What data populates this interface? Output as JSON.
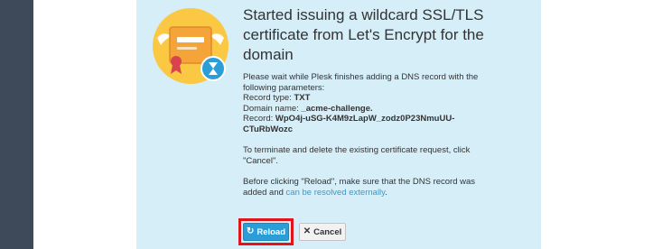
{
  "colors": {
    "panel_background": "#d6eef8",
    "accent": "#2b9ed8",
    "highlight_border": "#e0151b",
    "icon_circle": "#fbc843",
    "left_strip": "#3e4a5a"
  },
  "dialog": {
    "title": "Started issuing a wildcard SSL/TLS certificate from Let's Encrypt for the domain",
    "wait_message": "Please wait while Plesk finishes adding a DNS record with the following parameters:",
    "record_type_label": "Record type: ",
    "record_type_value": "TXT",
    "domain_name_label": "Domain name: ",
    "domain_name_value": "_acme-challenge.",
    "record_label": "Record: ",
    "record_value": "WpO4j-uSG-K4M9zLapW_zodz0P23NmuUU-CTuRbWozc",
    "terminate_message": "To terminate and delete the existing certificate request, click \"Cancel\".",
    "before_reload_prefix": "Before clicking \"Reload\", make sure that the DNS record was added and ",
    "resolved_link": "can be resolved externally",
    "before_reload_suffix": "."
  },
  "buttons": {
    "reload_label": "Reload",
    "reload_icon": "refresh-icon",
    "cancel_label": "Cancel",
    "cancel_icon": "close-icon"
  },
  "illustration": {
    "icon": "certificate-icon",
    "badge_icon": "hourglass-icon"
  }
}
